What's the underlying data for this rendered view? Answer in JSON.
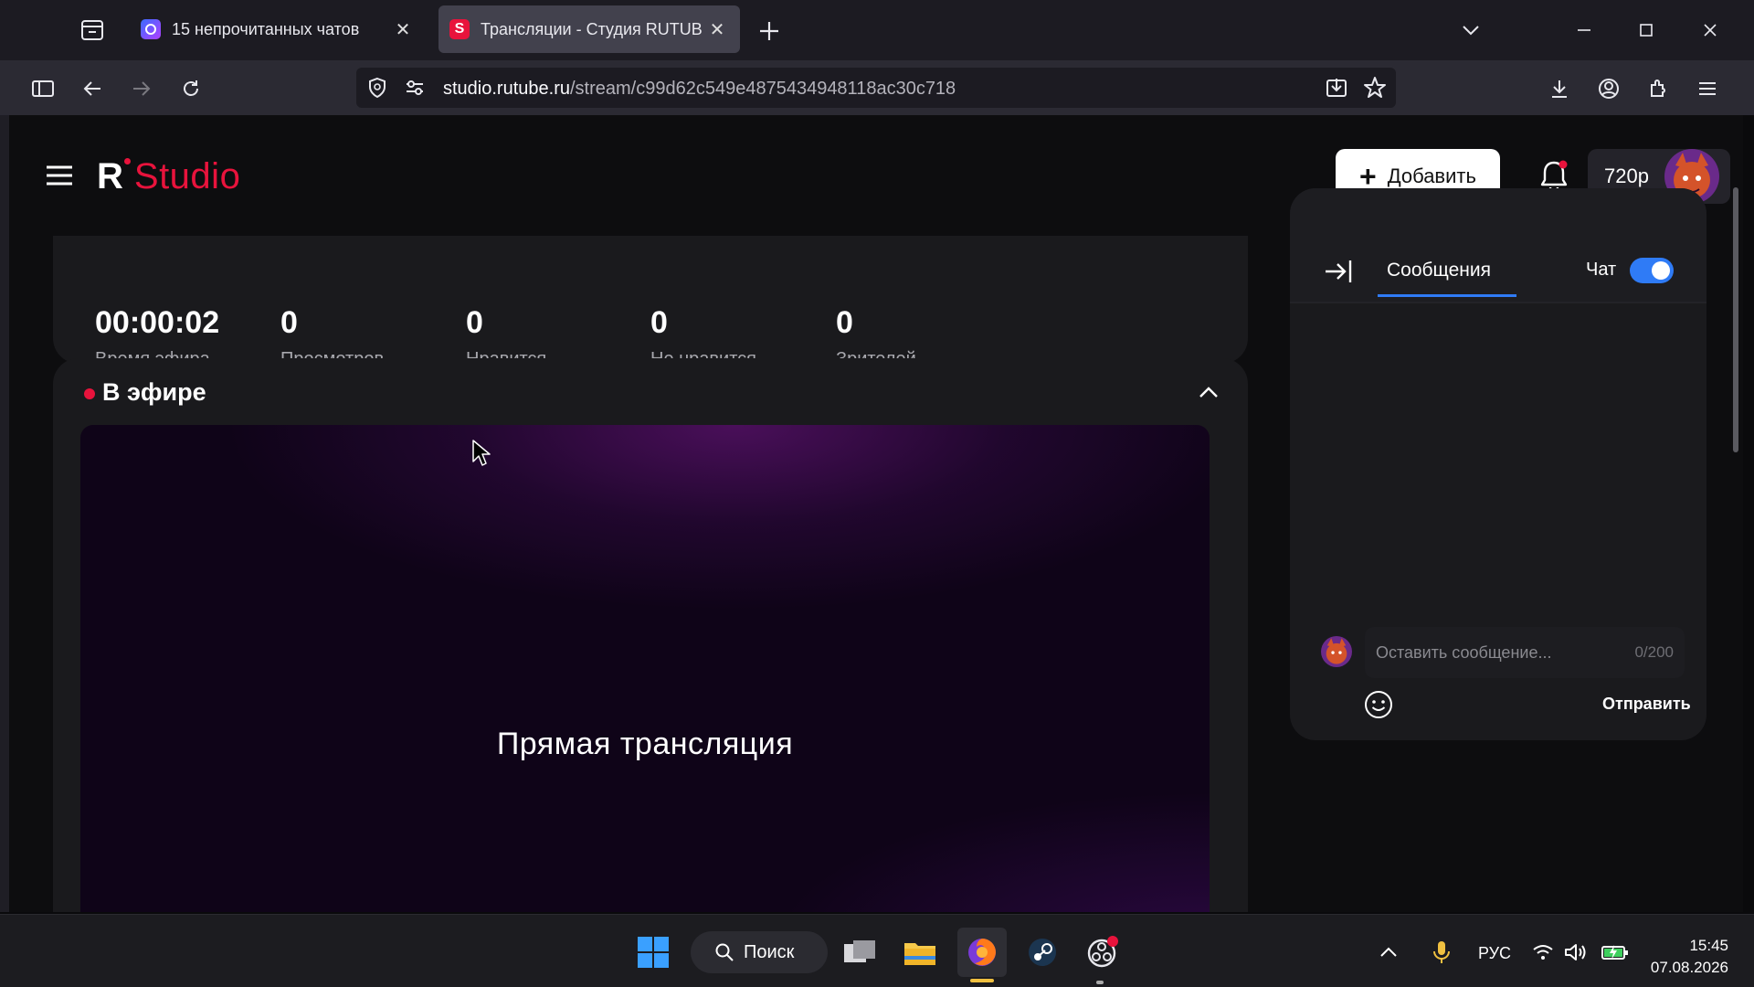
{
  "browser": {
    "tabs": [
      {
        "title": "15 непрочитанных чатов",
        "active": false
      },
      {
        "title": "Трансляции - Студия RUTUBE",
        "active": true
      }
    ],
    "url_host": "studio.rutube.ru",
    "url_path": "/stream/c99d62c549e4875434948118ac30c718"
  },
  "header": {
    "logo_r": "R",
    "logo_studio": "Studio",
    "add_label": "Добавить",
    "quality_label": "720p"
  },
  "stats": [
    {
      "value": "00:00:02",
      "label": "Время эфира"
    },
    {
      "value": "0",
      "label": "Просмотров"
    },
    {
      "value": "0",
      "label": "Нравится"
    },
    {
      "value": "0",
      "label": "Не нравится"
    },
    {
      "value": "0",
      "label": "Зрителей"
    }
  ],
  "live": {
    "title": "В эфире",
    "player_text": "Прямая трансляция"
  },
  "chat": {
    "tab_label": "Сообщения",
    "toggle_label": "Чат",
    "toggle_on": true,
    "input_placeholder": "Оставить сообщение...",
    "counter": "0/200",
    "send_label": "Отправить"
  },
  "taskbar": {
    "search_label": "Поиск",
    "lang": "РУС",
    "time": "15:45",
    "date": "07.08.2026"
  },
  "colors": {
    "accent_red": "#e8133c",
    "accent_blue": "#2f7bf6"
  }
}
